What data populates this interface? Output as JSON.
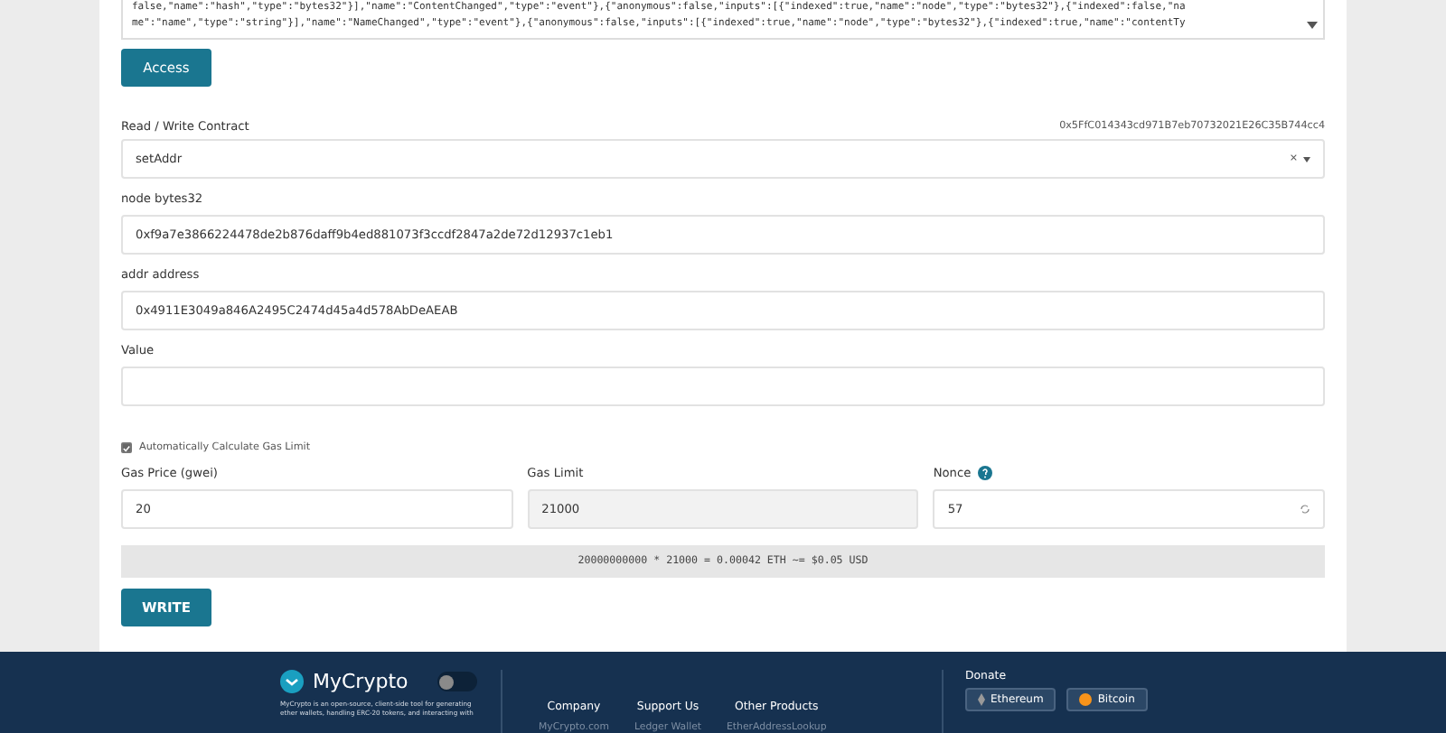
{
  "abi_lines": [
    "false,\"name\":\"hash\",\"type\":\"bytes32\"}],\"name\":\"ContentChanged\",\"type\":\"event\"},{\"anonymous\":false,\"inputs\":[{\"indexed\":true,\"name\":\"node\",\"type\":\"bytes32\"},{\"indexed\":false,\"na",
    "me\":\"name\",\"type\":\"string\"}],\"name\":\"NameChanged\",\"type\":\"event\"},{\"anonymous\":false,\"inputs\":[{\"indexed\":true,\"name\":\"node\",\"type\":\"bytes32\"},{\"indexed\":true,\"name\":\"contentTy"
  ],
  "access_button": "Access",
  "contract": {
    "label": "Read / Write Contract",
    "address": "0x5FfC014343cd971B7eb70732021E26C35B744cc4",
    "function": "setAddr",
    "clear": "×"
  },
  "inputs": [
    {
      "label": "node bytes32",
      "value": "0xf9a7e3866224478de2b876daff9b4ed881073f3ccdf2847a2de72d12937c1eb1"
    },
    {
      "label": "addr address",
      "value": "0x4911E3049a846A2495C2474d45a4d578AbDeAEAB"
    },
    {
      "label": "Value"
    }
  ],
  "auto_gas": {
    "label": "Automatically Calculate Gas Limit",
    "checked": true
  },
  "gas": [
    {
      "label": "Gas Price (gwei)",
      "value": "20",
      "kind": "editable"
    },
    {
      "label": "Gas Limit",
      "value": "21000",
      "kind": "readonly"
    },
    {
      "label": "Nonce",
      "value": "57",
      "kind": "refresh"
    }
  ],
  "fee": "20000000000 * 21000 = 0.00042 ETH ~= $0.05 USD",
  "write_button": "WRITE",
  "footer": {
    "brand": "MyCrypto",
    "toggle_on": false,
    "description": "MyCrypto is an open-source, client-side tool for generating ether wallets, handling ERC-20 tokens, and interacting with",
    "columns": [
      {
        "title": "Company",
        "link": "MyCrypto.com"
      },
      {
        "title": "Support Us",
        "link": "Ledger Wallet"
      },
      {
        "title": "Other Products",
        "link": "EtherAddressLookup"
      }
    ],
    "donate": {
      "title": "Donate",
      "buttons": [
        "Ethereum",
        "Bitcoin"
      ]
    }
  }
}
